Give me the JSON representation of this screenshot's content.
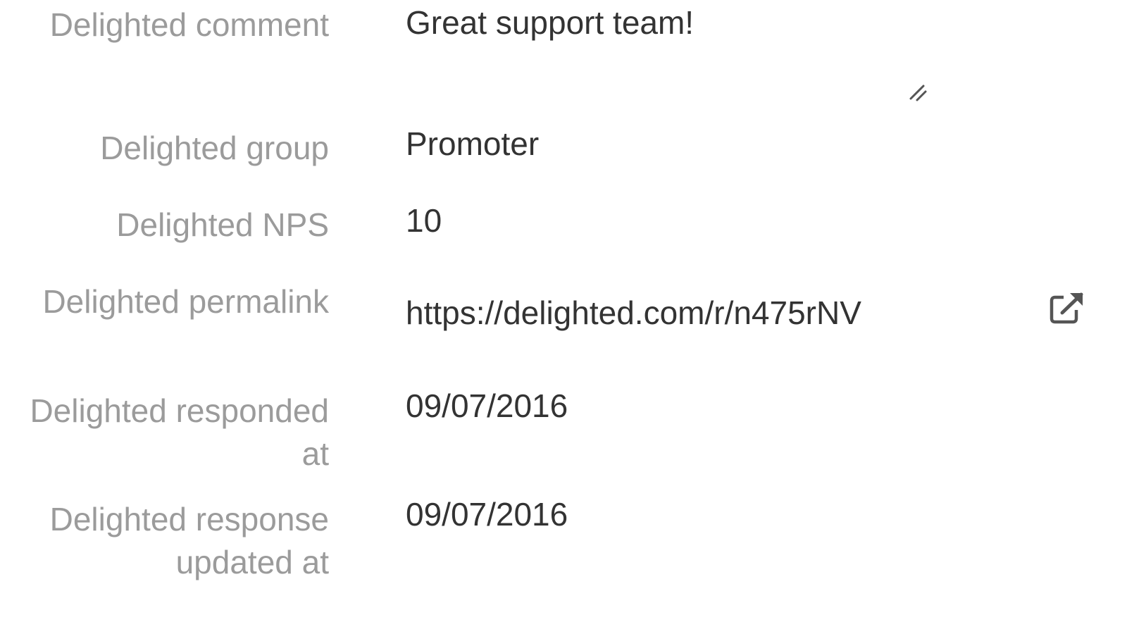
{
  "fields": {
    "comment": {
      "label": "Delighted comment",
      "value": "Great support team!"
    },
    "group": {
      "label": "Delighted group",
      "value": "Promoter"
    },
    "nps": {
      "label": "Delighted NPS",
      "value": "10"
    },
    "permalink": {
      "label": "Delighted permalink",
      "value": "https://delighted.com/r/n475rNV",
      "icon": "external-link-icon"
    },
    "responded_at": {
      "label": "Delighted responded at",
      "value": "09/07/2016"
    },
    "response_updated_at": {
      "label": "Delighted response updated at",
      "value": "09/07/2016"
    }
  },
  "colors": {
    "label": "#9b9b9b",
    "value": "#333333",
    "icon": "#555555"
  }
}
